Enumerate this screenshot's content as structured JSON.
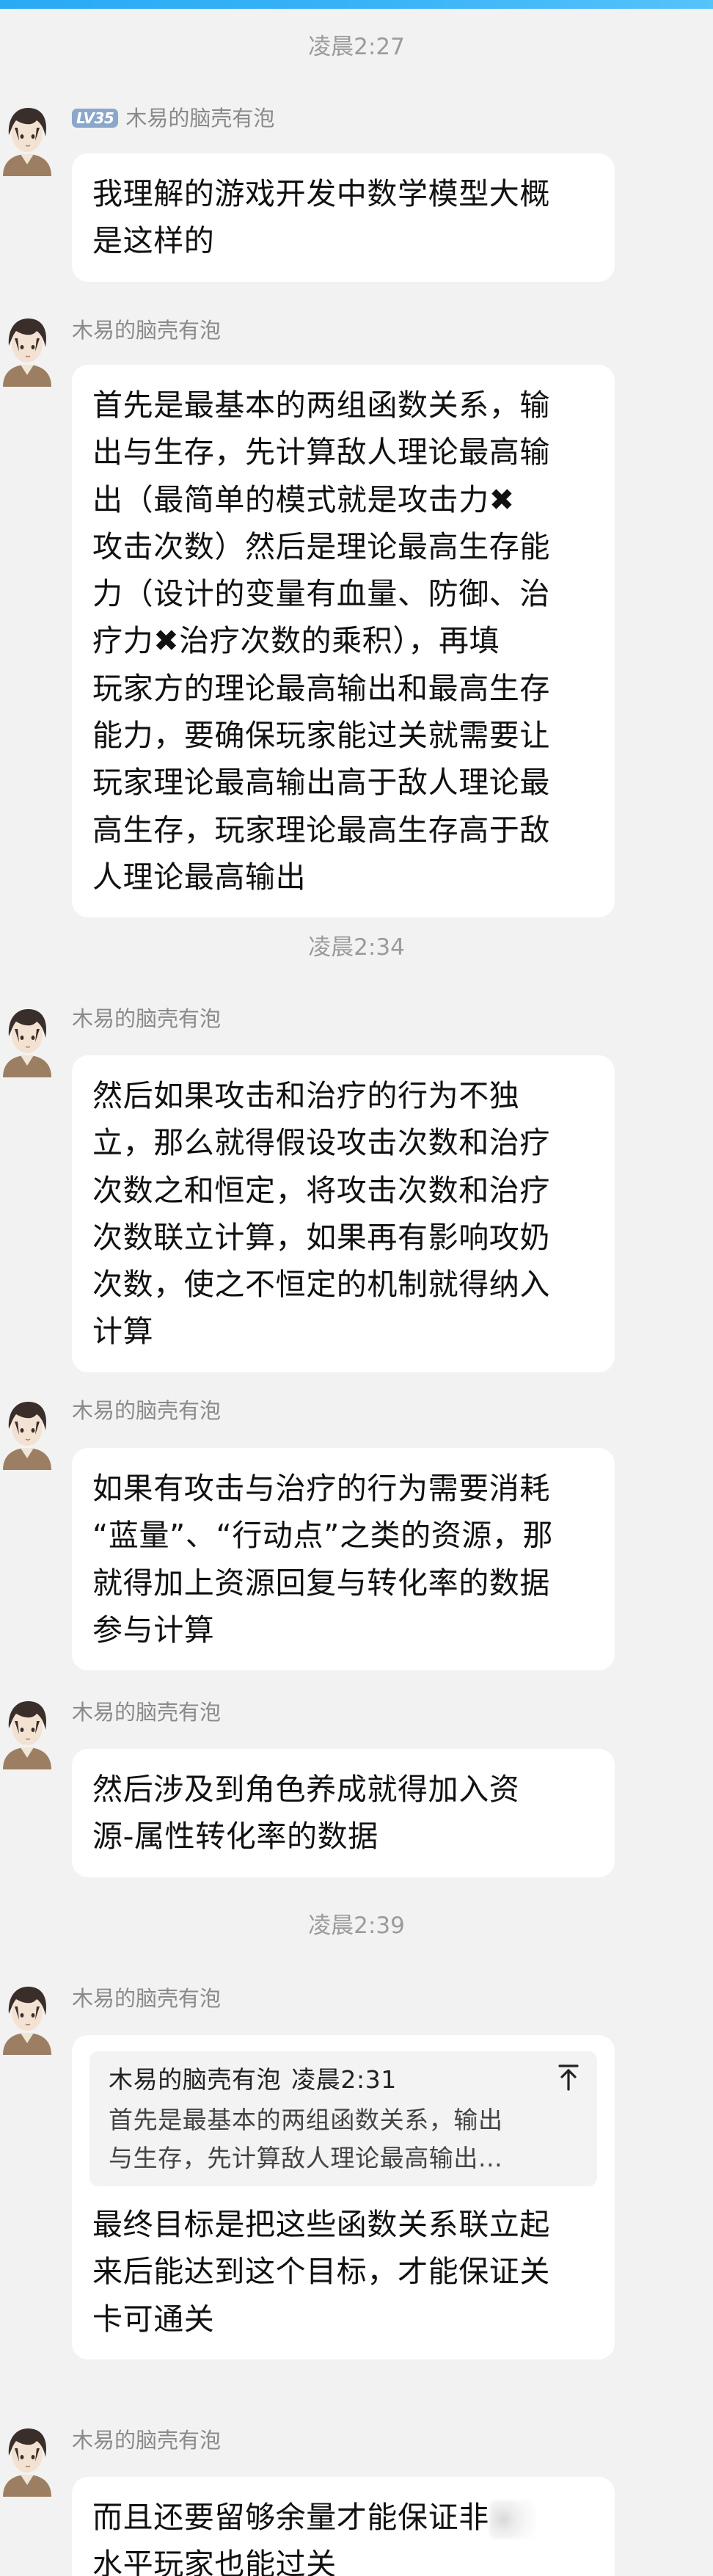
{
  "times": [
    "凌晨2:27",
    "凌晨2:34",
    "凌晨2:39"
  ],
  "sender": {
    "name": "木易的脑壳有泡",
    "level": "LV35"
  },
  "messages": [
    {
      "lines": [
        "我理解的游戏开发中数学模型大概",
        "是这样的"
      ]
    },
    {
      "lines": [
        "首先是最基本的两组函数关系，输",
        "出与生存，先计算敌人理论最高输",
        "出（最简单的模式就是攻击力✖",
        "攻击次数）然后是理论最高生存能",
        "力（设计的变量有血量、防御、治",
        "疗力✖治疗次数的乘积），再填",
        "玩家方的理论最高输出和最高生存",
        "能力，要确保玩家能过关就需要让",
        "玩家理论最高输出高于敌人理论最",
        "高生存，玩家理论最高生存高于敌",
        "人理论最高输出"
      ]
    },
    {
      "lines": [
        "然后如果攻击和治疗的行为不独",
        "立，那么就得假设攻击次数和治疗",
        "次数之和恒定，将攻击次数和治疗",
        "次数联立计算，如果再有影响攻奶",
        "次数，使之不恒定的机制就得纳入",
        "计算"
      ]
    },
    {
      "lines": [
        "如果有攻击与治疗的行为需要消耗",
        "“蓝量”、“行动点”之类的资源，那",
        "就得加上资源回复与转化率的数据",
        "参与计算"
      ]
    },
    {
      "lines": [
        "然后涉及到角色养成就得加入资",
        "源-属性转化率的数据"
      ]
    },
    {
      "quote": {
        "name": "木易的脑壳有泡",
        "time": "凌晨2:31",
        "lines": [
          "首先是最基本的两组函数关系，输出",
          "与生存，先计算敌人理论最高输出..."
        ]
      },
      "lines": [
        "最终目标是把这些函数关系联立起",
        "来后能达到这个目标，才能保证关",
        "卡可通关"
      ]
    },
    {
      "lines": [
        "而且还要留够余量才能保证非",
        "水平玩家也能过关"
      ]
    }
  ],
  "icons": {
    "quote_jump": "arrow-up-to-top-icon",
    "avatar": "anime-avatar"
  },
  "colors": {
    "background": "#f2f2f2",
    "bubble": "#ffffff",
    "time_text": "#9b9b9b",
    "sender_text": "#8a8a8a",
    "level_badge": "#8ba7cb",
    "top_bar": "#37b3f7"
  }
}
